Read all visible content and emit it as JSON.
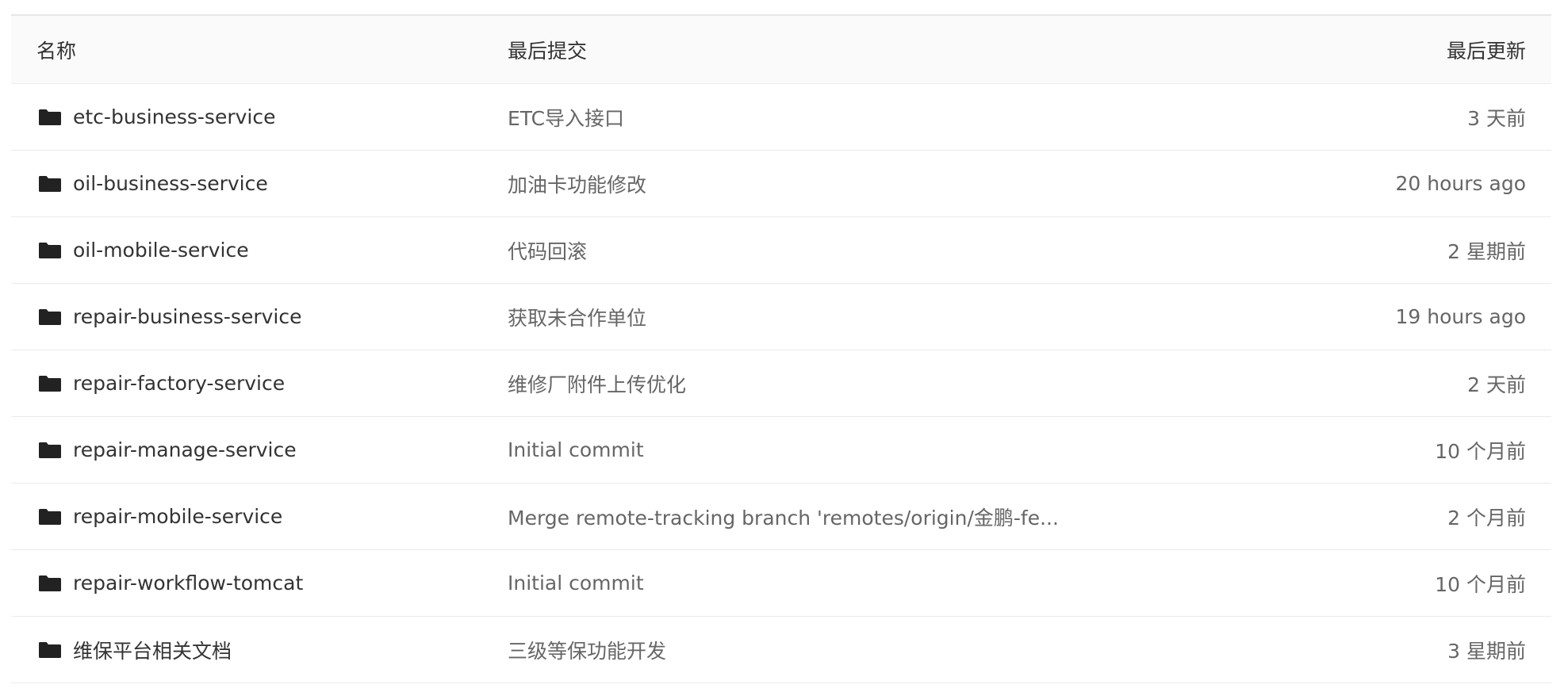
{
  "table": {
    "headers": {
      "name": "名称",
      "last_commit": "最后提交",
      "last_updated": "最后更新"
    },
    "rows": [
      {
        "icon": "folder-icon",
        "name": "etc-business-service",
        "commit": "ETC导入接口",
        "updated": "3 天前"
      },
      {
        "icon": "folder-icon",
        "name": "oil-business-service",
        "commit": "加油卡功能修改",
        "updated": "20 hours ago"
      },
      {
        "icon": "folder-icon",
        "name": "oil-mobile-service",
        "commit": "代码回滚",
        "updated": "2 星期前"
      },
      {
        "icon": "folder-icon",
        "name": "repair-business-service",
        "commit": "获取未合作单位",
        "updated": "19 hours ago"
      },
      {
        "icon": "folder-icon",
        "name": "repair-factory-service",
        "commit": "维修厂附件上传优化",
        "updated": "2 天前"
      },
      {
        "icon": "folder-icon",
        "name": "repair-manage-service",
        "commit": "Initial commit",
        "updated": "10 个月前"
      },
      {
        "icon": "folder-icon",
        "name": "repair-mobile-service",
        "commit": "Merge remote-tracking branch 'remotes/origin/金鹏-fe...",
        "updated": "2 个月前"
      },
      {
        "icon": "folder-icon",
        "name": "repair-workflow-tomcat",
        "commit": "Initial commit",
        "updated": "10 个月前"
      },
      {
        "icon": "folder-icon",
        "name": "维保平台相关文档",
        "commit": "三级等保功能开发",
        "updated": "3 星期前"
      }
    ]
  },
  "colors": {
    "header_bg": "#fafafa",
    "border": "#ebebeb",
    "text_primary": "#333333",
    "text_secondary": "#666666",
    "icon": "#222222"
  }
}
